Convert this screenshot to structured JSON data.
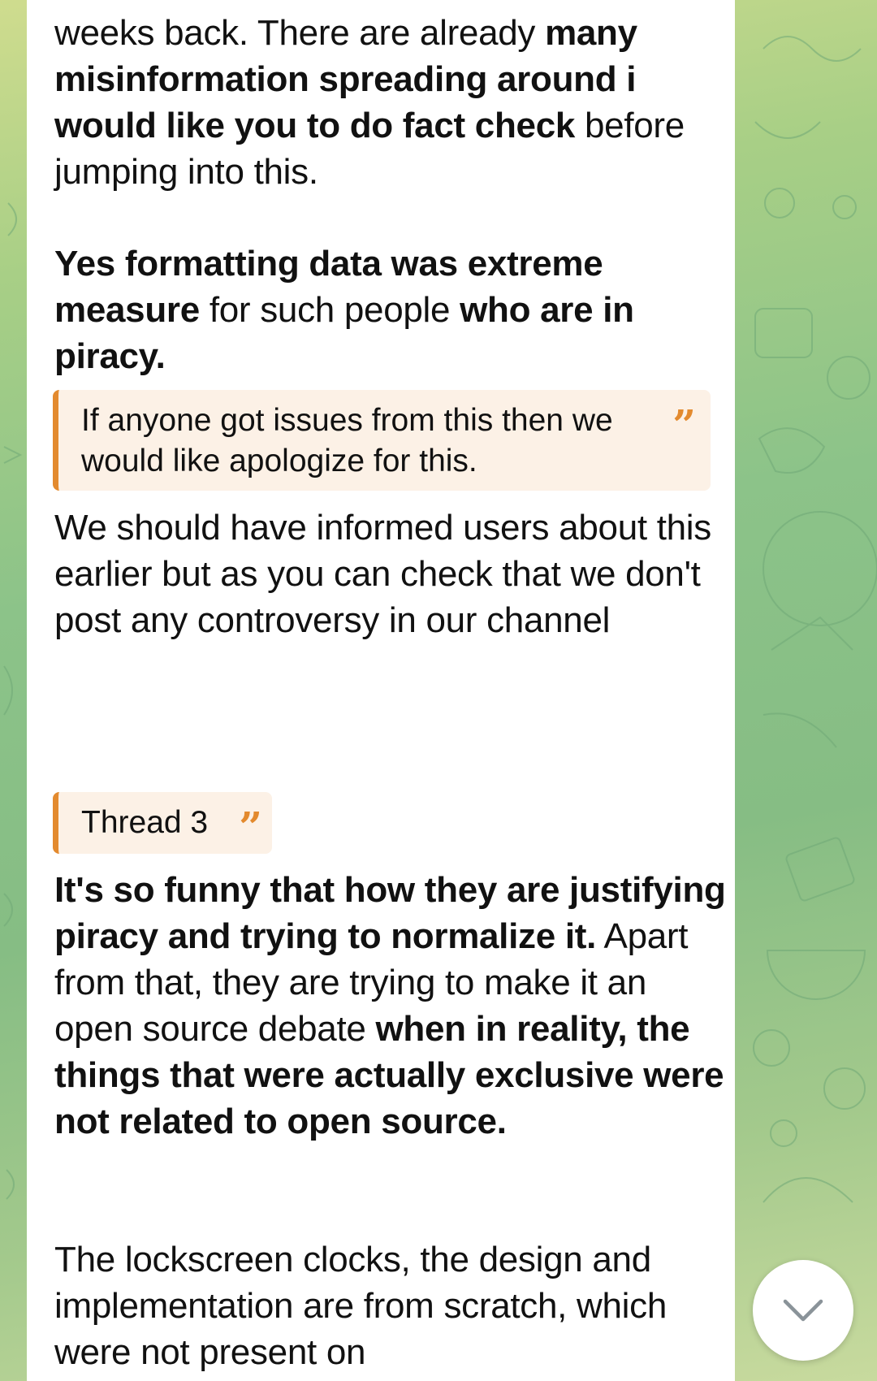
{
  "colors": {
    "accent": "#e38a2e",
    "quote_bg": "#fcf1e6",
    "bubble_bg": "#ffffff",
    "text": "#111111"
  },
  "message": {
    "para1": {
      "p1": "weeks back. There are already ",
      "b1": "many misinformation spreading around i would like you to do fact check",
      "p2": " before jumping into this."
    },
    "para2": {
      "b1": "Yes formatting data was extreme measure",
      "p1": " for such people ",
      "b2": "who are in piracy."
    },
    "quote1": {
      "text": "If anyone got issues from this then we would like apologize for this.",
      "icon": "quote-icon"
    },
    "para3": "We should have informed users about this earlier but as you can check that we don't post any controversy in our channel",
    "quote2": {
      "text": "Thread 3",
      "icon": "quote-icon"
    },
    "para4": {
      "b1": "It's so funny that how they are justifying piracy and trying to normalize it.",
      "p1": " Apart from that, they are trying to make it an open source debate ",
      "b2": "when in reality, the things that were actually exclusive were not related to open source."
    },
    "para5": "The lockscreen clocks, the design and implementation are from scratch, which were not present on"
  },
  "scroll_button": {
    "icon": "chevron-down-icon"
  }
}
